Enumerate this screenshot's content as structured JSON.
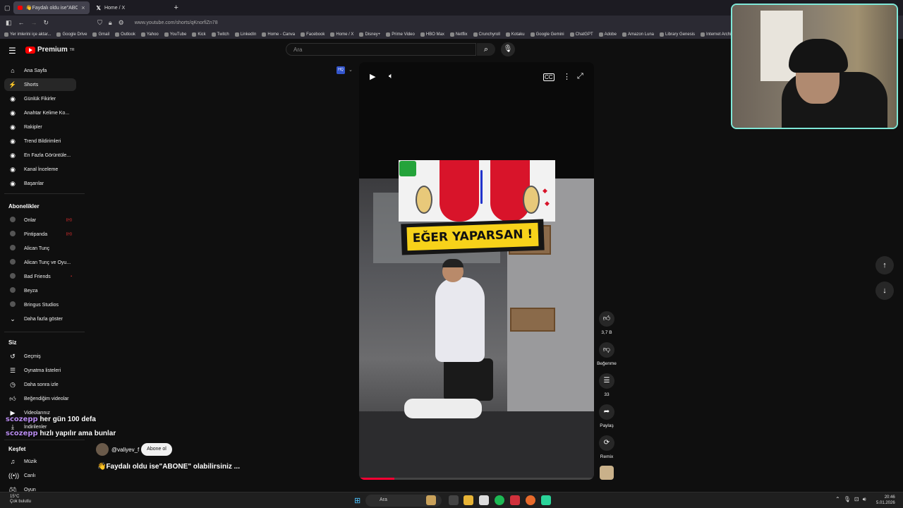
{
  "browser": {
    "tabs": [
      {
        "title": "👋Faydalı oldu ise\"ABONE\" olab",
        "active": true
      },
      {
        "title": "Home / X",
        "active": false
      }
    ],
    "new_tab": "+",
    "url": "www.youtube.com/shorts/qKnorfiZn78",
    "bookmarks": [
      "Yer imlerini içe aktar...",
      "Google Drive",
      "Gmail",
      "Outlook",
      "Yahoo",
      "YouTube",
      "Kick",
      "Twitch",
      "LinkedIn",
      "Home - Canva",
      "Facebook",
      "Home / X",
      "Disney+",
      "Prime Video",
      "HBO Max",
      "Netflix",
      "Crunchyroll",
      "Kotaku",
      "Google Gemini",
      "ChatGPT",
      "Adobe",
      "Amazon Luna",
      "Library Genesis",
      "Internet Archive"
    ]
  },
  "header": {
    "logo": "Premium",
    "logo_sup": "TR",
    "search_placeholder": "Ara"
  },
  "sidebar": {
    "main": [
      {
        "label": "Ana Sayfa",
        "icon": "home-icon"
      },
      {
        "label": "Shorts",
        "icon": "shorts-icon",
        "active": true
      }
    ],
    "tools": [
      "Günlük Fikirler",
      "Anahtar Kelime Ko...",
      "Rakipler",
      "Trend Bildirimleri",
      "En Fazla Görüntüle...",
      "Kanal İnceleme",
      "Başarılar"
    ],
    "subscriptions_title": "Abonelikler",
    "subscriptions": [
      {
        "label": "Onlar",
        "live": "((•))"
      },
      {
        "label": "Pintipanda",
        "live": "((•))"
      },
      {
        "label": "Alican Tunç",
        "live": ""
      },
      {
        "label": "Alican Tunç ve Oyu...",
        "live": ""
      },
      {
        "label": "Bad Friends",
        "live": "•"
      },
      {
        "label": "Beyza",
        "live": ""
      },
      {
        "label": "Bringus Studios",
        "live": ""
      }
    ],
    "show_more": "Daha fazla göster",
    "you_title": "Siz",
    "you_items": [
      "Geçmiş",
      "Oynatma listeleri",
      "Daha sonra izle",
      "Beğendiğim videolar",
      "Videolarınız",
      "İndirilenler"
    ],
    "explore_title": "Keşfet",
    "explore_items": [
      "Müzik",
      "Canlı",
      "Oyun"
    ]
  },
  "chat": [
    {
      "user": "scozepp",
      "message": "her gün 100 defa"
    },
    {
      "user": "scozepp",
      "message": "hızlı yapılır ama bunlar"
    }
  ],
  "video": {
    "banner_text": "EĞER YAPARSAN !",
    "progress": 0.15,
    "quality_badge": "HQ"
  },
  "actions": {
    "like_count": "3,7 B",
    "dislike_label": "Beğenme",
    "comment_count": "33",
    "share_label": "Paylaş",
    "remix_label": "Remix"
  },
  "channel": {
    "name": "@valiyev_f",
    "subscribe_label": "Abone ol",
    "title": "👋Faydalı oldu ise\"ABONE\" olabilirsiniz ..."
  },
  "taskbar": {
    "temperature": "15°C",
    "weather": "Çok bulutlu",
    "search": "Ara",
    "time": "20:46",
    "date": "5.01.2026"
  },
  "colors": {
    "accent_red": "#ff0000",
    "webcam_border": "#7fe8d8",
    "chat_user": "#b98cf0",
    "banner_yellow": "#f7d21a"
  }
}
